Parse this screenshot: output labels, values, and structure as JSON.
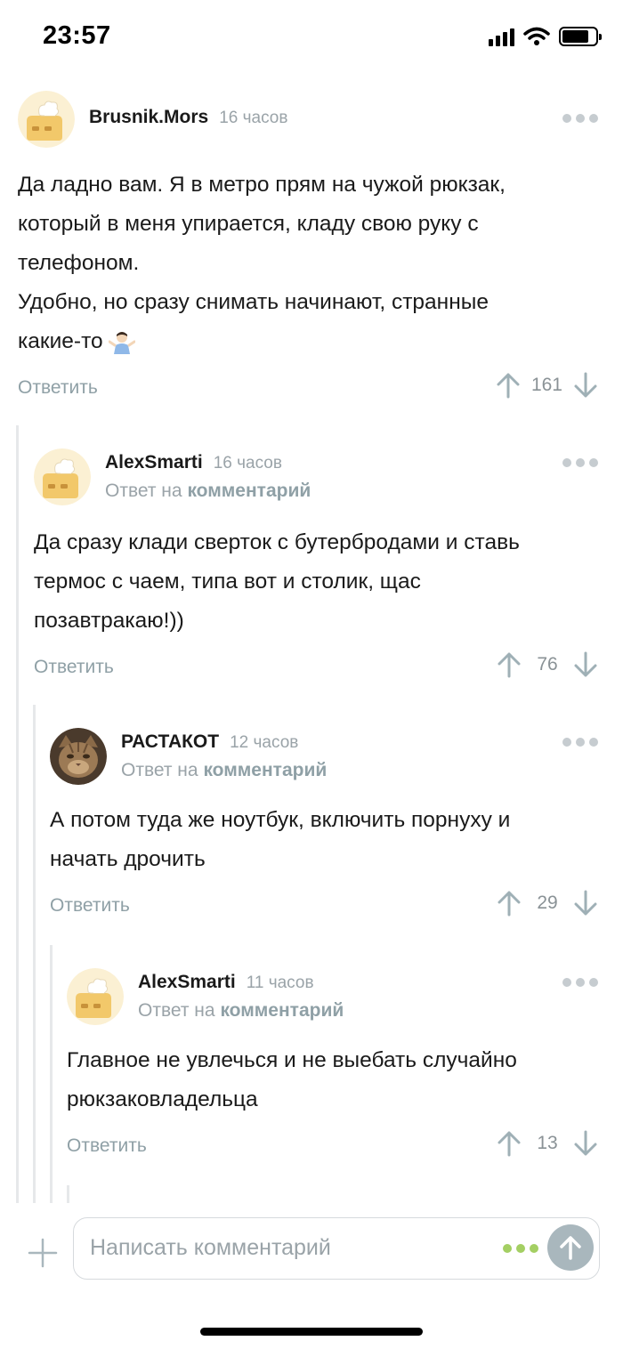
{
  "status_bar": {
    "time": "23:57"
  },
  "comments": [
    {
      "author": "Brusnik.Mors",
      "time": "16 часов",
      "text": "Да ладно вам. Я в метро прям на чужой рюкзак,\nкоторый в меня упирается, кладу свою руку с\nтелефоном.\nУдобно, но сразу снимать начинают, странные\nкакие-то",
      "emoji": "person-shrugging-emoji",
      "reply_label": "Ответить",
      "votes": "161"
    },
    {
      "author": "AlexSmarti",
      "time": "16 часов",
      "reply_prefix": "Ответ на",
      "reply_link": "комментарий",
      "text": "Да сразу клади сверток с бутербродами и ставь\nтермос с чаем, типа вот и столик, щас\nпозавтракаю!))",
      "reply_label": "Ответить",
      "votes": "76"
    },
    {
      "author": "РАСТАКОТ",
      "time": "12 часов",
      "reply_prefix": "Ответ на",
      "reply_link": "комментарий",
      "text": "А потом туда же ноутбук, включить порнуху и\nначать дрочить",
      "reply_label": "Ответить",
      "votes": "29"
    },
    {
      "author": "AlexSmarti",
      "time": "11 часов",
      "reply_prefix": "Ответ на",
      "reply_link": "комментарий",
      "text": "Главное не увлечься и не выебать случайно\nрюкзаковладельца",
      "reply_label": "Ответить",
      "votes": "13"
    }
  ],
  "composer": {
    "placeholder": "Написать комментарий"
  },
  "icons": {
    "more": "more-dots-icon",
    "upvote": "arrow-up-icon",
    "downvote": "arrow-down-icon",
    "add": "plus-icon",
    "send": "send-arrow-icon",
    "avatar_default": "default-avatar-icon"
  },
  "colors": {
    "accent_green": "#a4cf63",
    "muted": "#8fa0a6",
    "send_button": "#a9b7bd"
  }
}
